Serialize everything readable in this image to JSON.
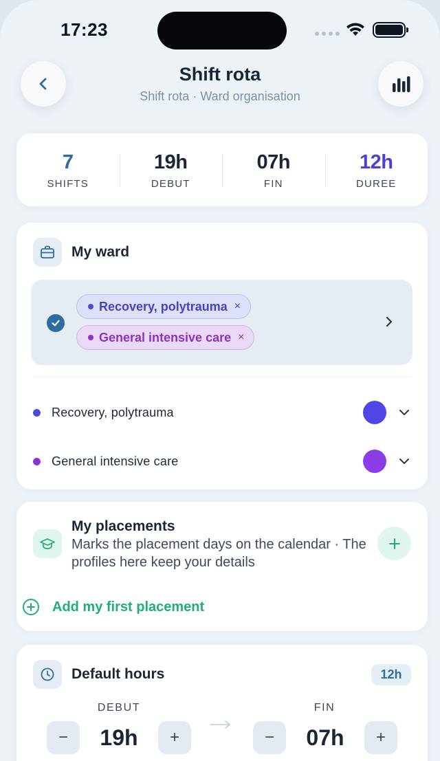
{
  "status_bar": {
    "time": "17:23"
  },
  "header": {
    "title": "Shift rota",
    "subtitle": "Shift rota · Ward organisation"
  },
  "summary": [
    {
      "value": "7",
      "label": "SHIFTS",
      "color": "#2e6b9e"
    },
    {
      "value": "19h",
      "label": "DEBUT",
      "color": "#1a2536"
    },
    {
      "value": "07h",
      "label": "FIN",
      "color": "#1a2536"
    },
    {
      "value": "12h",
      "label": "DUREE",
      "color": "#4b3fd6"
    }
  ],
  "ward": {
    "title": "My ward",
    "selected_chips": [
      {
        "label": "Recovery, polytrauma",
        "remove": "×"
      },
      {
        "label": "General intensive care",
        "remove": "×"
      }
    ],
    "rows": [
      {
        "label": "Recovery, polytrauma",
        "color": "#4f46e5"
      },
      {
        "label": "General intensive care",
        "color": "#8b3ee8"
      }
    ]
  },
  "placements": {
    "title": "My placements",
    "description": "Marks the placement days on the calendar · The profiles here keep your details",
    "add_label": "Add my first placement"
  },
  "default_hours": {
    "title": "Default hours",
    "badge": "12h",
    "start": {
      "label": "DEBUT",
      "value": "19h",
      "decrement": "−",
      "increment": "+"
    },
    "end": {
      "label": "FIN",
      "value": "07h",
      "decrement": "−",
      "increment": "+"
    }
  },
  "colors": {
    "accent_green": "#1fae74",
    "accent_blue": "#2e6b9e",
    "background": "#edf2f7"
  }
}
